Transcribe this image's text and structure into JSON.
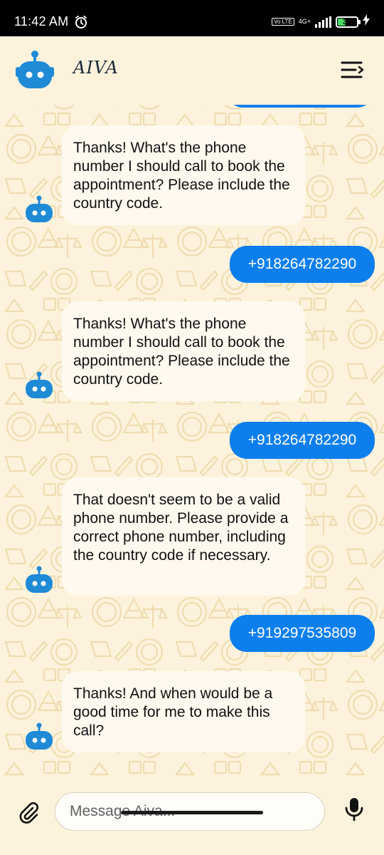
{
  "status_bar": {
    "time": "11:42 AM",
    "network": "4G+",
    "volte": "Vo LTE",
    "battery": "39",
    "battery_level": 0.39,
    "charging": true
  },
  "header": {
    "brand": "AIVA",
    "avatar_icon": "robot-icon",
    "menu_icon": "menu-icon"
  },
  "messages": [
    {
      "sender": "bot",
      "text": "Thanks! What's the phone number I should call to book the appointment? Please include the country code."
    },
    {
      "sender": "user",
      "text": "+918264782290"
    },
    {
      "sender": "bot",
      "text": "Thanks! What's the phone number I should call to book the appointment? Please include the country code."
    },
    {
      "sender": "user",
      "text": "+918264782290"
    },
    {
      "sender": "bot",
      "text": "That doesn't seem to be a valid phone number. Please provide a correct phone number, including the country code if necessary."
    },
    {
      "sender": "user",
      "text": "+919297535809"
    },
    {
      "sender": "bot",
      "text": "Thanks! And when would be a good time for me to make this call?"
    }
  ],
  "composer": {
    "placeholder": "Message Aiva...",
    "attach_icon": "paperclip-icon",
    "mic_icon": "microphone-icon"
  },
  "colors": {
    "background": "#fdf3dc",
    "user_bubble": "#0d7fec",
    "bot_bubble": "#fff9ef",
    "robot_blue": "#1f8ad6"
  }
}
